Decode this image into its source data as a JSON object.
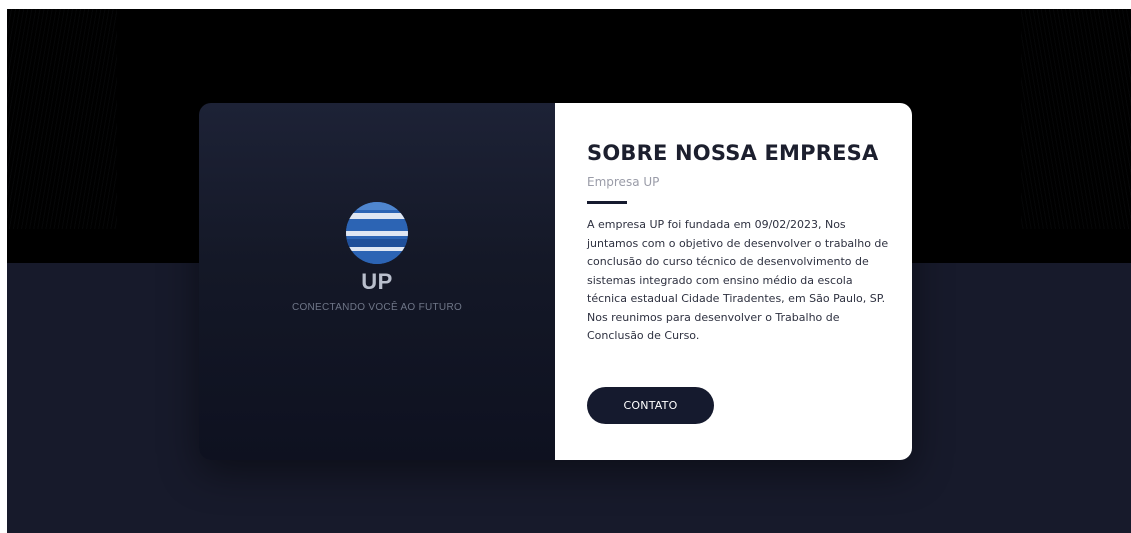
{
  "brand": {
    "name": "UP",
    "tagline": "CONECTANDO VOCÊ AO FUTURO",
    "logo_icon": "striped-globe-logo"
  },
  "about": {
    "title": "SOBRE NOSSA EMPRESA",
    "subtitle": "Empresa UP",
    "body": "A empresa UP foi fundada em 09/02/2023, Nos juntamos com o objetivo de desenvolver o trabalho de conclusão do curso técnico de desenvolvimento de sistemas integrado com ensino médio da escola técnica estadual Cidade Tiradentes, em São Paulo, SP. Nos reunimos para desenvolver o Trabalho de Conclusão de Curso.",
    "cta_label": "CONTATO"
  },
  "colors": {
    "navy": "#151a2e",
    "page_top": "#000000",
    "page_bottom": "#171a2b",
    "logo_blue": "#2c64b4",
    "logo_light": "#dfe6f2"
  }
}
